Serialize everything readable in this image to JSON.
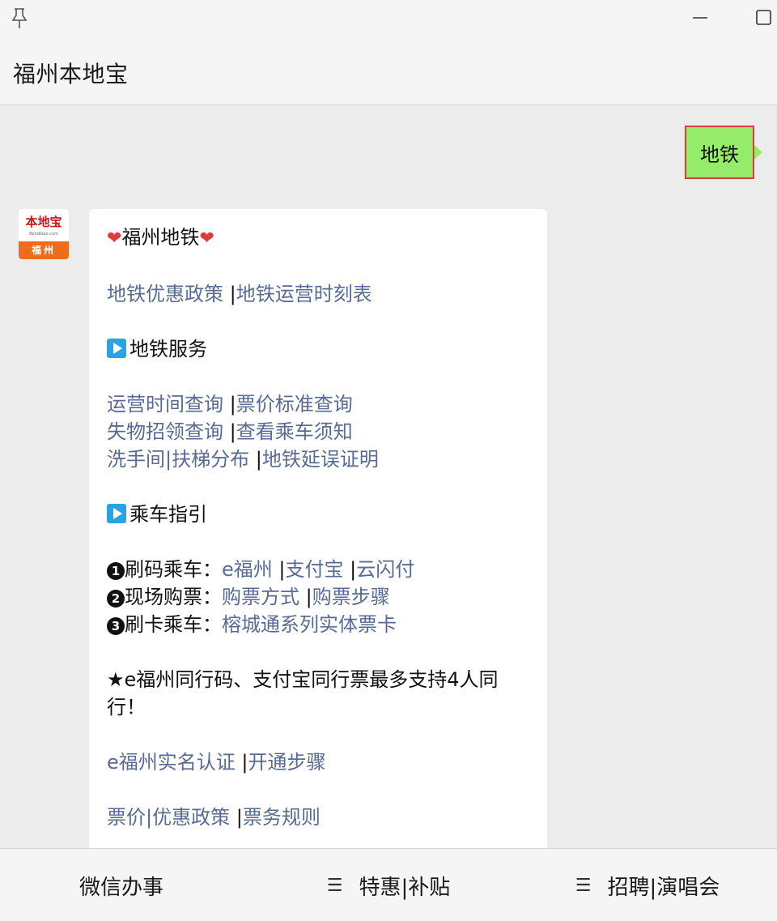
{
  "window": {
    "title": "福州本地宝",
    "pin_icon": "pin-icon",
    "minimize_icon": "minimize-icon",
    "maximize_icon": "maximize-icon"
  },
  "chat": {
    "my_message": "地铁",
    "avatar": {
      "logo_text": "本地宝",
      "sub_text": "Bendibao.com",
      "city_text": "福州"
    },
    "bot_message": {
      "title": "福州地铁",
      "row1": {
        "link1": "地铁优惠政策 ",
        "sep": "|",
        "link2": "地铁运营时刻表"
      },
      "section1_title": "地铁服务",
      "row2": {
        "link1": "运营时间查询 ",
        "sep": "|",
        "link2": "票价标准查询"
      },
      "row3": {
        "link1": "失物招领查询 ",
        "sep": "|",
        "link2": "查看乘车须知"
      },
      "row4": {
        "link1": "洗手间",
        "sep1": "|",
        "link2": "扶梯分布 ",
        "sep2": "|",
        "link3": "地铁延误证明"
      },
      "section2_title": "乘车指引",
      "guide1": {
        "num": "1",
        "label": "刷码乘车：",
        "link1": "e福州 ",
        "sep1": "|",
        "link2": "支付宝 ",
        "sep2": "|",
        "link3": "云闪付"
      },
      "guide2": {
        "num": "2",
        "label": "现场购票：",
        "link1": "购票方式 ",
        "sep1": "|",
        "link2": "购票步骤"
      },
      "guide3": {
        "num": "3",
        "label": "刷卡乘车：",
        "link1": "榕城通系列实体票卡"
      },
      "note": "★e福州同行码、支付宝同行票最多支持4人同行！",
      "row5": {
        "link1": "e福州实名认证 ",
        "sep": "|",
        "link2": "开通步骤"
      },
      "row6": {
        "link1": "票价",
        "sep1": "|",
        "link2": "优惠政策 ",
        "sep2": "|",
        "link3": "票务规则"
      }
    }
  },
  "bottom_menu": {
    "item1": "微信办事",
    "item2": "特惠|补贴",
    "item3": "招聘|演唱会",
    "menu_icon": "☰"
  },
  "colors": {
    "link": "#576b95",
    "my_bubble": "#95ec69",
    "highlight_border": "#e0393e"
  }
}
